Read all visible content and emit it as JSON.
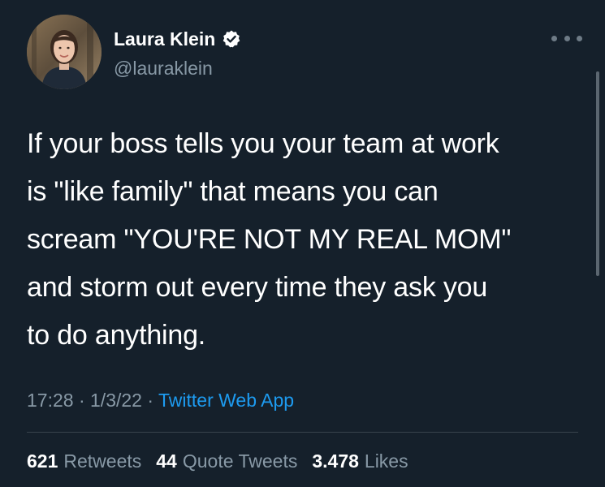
{
  "author": {
    "name": "Laura Klein",
    "handle": "@lauraklein",
    "verified": true,
    "avatar_icon": "profile-photo"
  },
  "tweet": {
    "text": "If your boss tells you your team at work\nis \"like family\" that means you can\nscream \"YOU'RE NOT MY REAL MOM\"\nand storm out every time they ask you\nto do anything."
  },
  "meta": {
    "time": "17:28",
    "separator": " · ",
    "date": "1/3/22",
    "source": "Twitter Web App"
  },
  "stats": {
    "retweets_count": "621",
    "retweets_label": "Retweets",
    "quotes_count": "44",
    "quotes_label": "Quote Tweets",
    "likes_count": "3.478",
    "likes_label": "Likes"
  },
  "colors": {
    "background": "#15202b",
    "secondary_text": "#8899a6",
    "link": "#1d9bf0",
    "verified_badge": "#ffffff"
  },
  "icons": {
    "more": "more-horizontal-icon",
    "verified": "verified-badge-icon"
  }
}
